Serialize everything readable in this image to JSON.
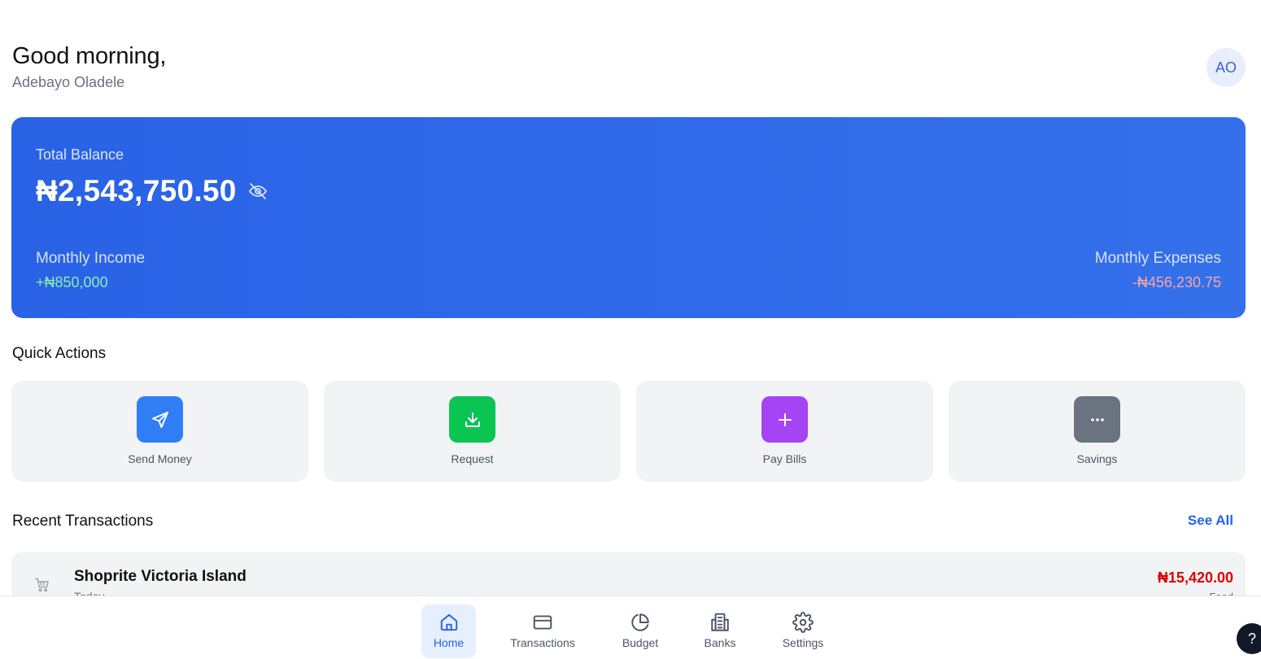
{
  "header": {
    "greeting": "Good morning,",
    "user_name": "Adebayo Oladele",
    "avatar_initials": "AO"
  },
  "balance_card": {
    "label": "Total Balance",
    "amount": "₦2,543,750.50",
    "visibility_icon": "eye-off-icon",
    "monthly_income_label": "Monthly Income",
    "monthly_income_value": "+₦850,000",
    "monthly_expenses_label": "Monthly Expenses",
    "monthly_expenses_value": "-₦456,230.75"
  },
  "quick_actions": {
    "title": "Quick Actions",
    "items": [
      {
        "label": "Send Money",
        "icon": "send-icon",
        "color": "#2f7ef5"
      },
      {
        "label": "Request",
        "icon": "download-icon",
        "color": "#0ac552"
      },
      {
        "label": "Pay Bills",
        "icon": "plus-icon",
        "color": "#a544f5"
      },
      {
        "label": "Savings",
        "icon": "more-icon",
        "color": "#6b7280"
      }
    ]
  },
  "recent_transactions": {
    "title": "Recent Transactions",
    "see_all": "See All",
    "items": [
      {
        "merchant": "Shoprite Victoria Island",
        "date": "Today",
        "amount": "₦15,420.00",
        "category": "Food",
        "icon": "cart-icon"
      }
    ]
  },
  "bottom_nav": {
    "items": [
      {
        "label": "Home",
        "icon": "home-icon",
        "active": true
      },
      {
        "label": "Transactions",
        "icon": "credit-card-icon",
        "active": false
      },
      {
        "label": "Budget",
        "icon": "pie-chart-icon",
        "active": false
      },
      {
        "label": "Banks",
        "icon": "bank-icon",
        "active": false
      },
      {
        "label": "Settings",
        "icon": "gear-icon",
        "active": false
      }
    ]
  },
  "help_button": {
    "label": "?"
  },
  "colors": {
    "primary": "#2563eb",
    "income": "#86efac",
    "expenses": "#fca5a5",
    "debit": "#dc0000"
  }
}
